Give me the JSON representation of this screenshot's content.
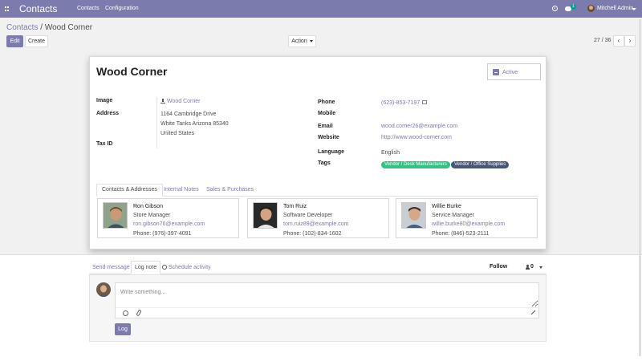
{
  "topbar": {
    "app_title": "Contacts",
    "menu": [
      "Contacts",
      "Configuration"
    ],
    "chat_badge": "1",
    "user_name": "Mitchell Admin"
  },
  "control": {
    "breadcrumb_parent": "Contacts",
    "breadcrumb_sep": "/",
    "breadcrumb_current": "Wood Corner",
    "edit_label": "Edit",
    "create_label": "Create",
    "action_label": "Action",
    "pager": "27 / 36",
    "prev_label": "‹",
    "next_label": "›"
  },
  "record": {
    "name": "Wood Corner",
    "active_label": "Active",
    "labels": {
      "image": "Image",
      "address": "Address",
      "tax_id": "Tax ID",
      "phone": "Phone",
      "mobile": "Mobile",
      "email": "Email",
      "website": "Website",
      "language": "Language",
      "tags": "Tags"
    },
    "image_link": "Wood Corner",
    "address_line1": "1164 Cambridge Drive",
    "address_line2": "White Tanks  Arizona  85340",
    "address_line3": "United States",
    "phone": "(623)-853-7197",
    "email": "wood.corner26@example.com",
    "website": "http://www.wood-corner.com",
    "language": "English",
    "tags": [
      {
        "label": "Vendor / Desk Manufacturers",
        "color": "#30c381"
      },
      {
        "label": "Vendor / Office Supplies",
        "color": "#475577"
      }
    ]
  },
  "notebook": {
    "tabs": [
      "Contacts & Addresses",
      "Internal Notes",
      "Sales & Purchases"
    ],
    "contacts": [
      {
        "name": "Ron Gibson",
        "function": "Store Manager",
        "email": "ron.gibson76@example.com",
        "phone": "Phone: (976)-397-4091"
      },
      {
        "name": "Tom Ruiz",
        "function": "Software Developer",
        "email": "tom.ruiz89@example.com",
        "phone": "Phone: (102)-834-1602"
      },
      {
        "name": "Willie Burke",
        "function": "Service Manager",
        "email": "willie.burke80@example.com",
        "phone": "Phone: (846)-523-2111"
      }
    ]
  },
  "chatter": {
    "send_message": "Send message",
    "log_note": "Log note",
    "schedule_activity": "Schedule activity",
    "follow": "Follow",
    "followers_count": "0",
    "placeholder": "Write something...",
    "log_button": "Log"
  },
  "colors": {
    "brand": "#7c7bad",
    "link": "#7c7bad"
  }
}
